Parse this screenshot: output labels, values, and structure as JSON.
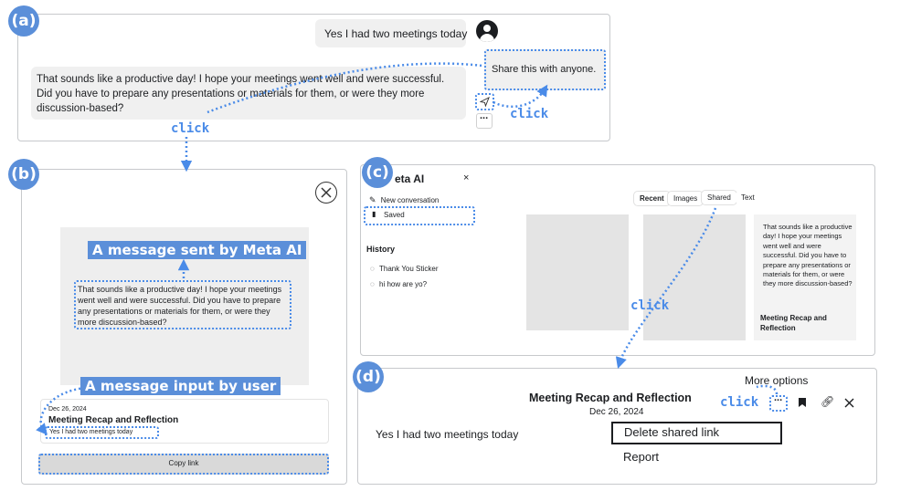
{
  "panel_a": {
    "badge": "(a)",
    "user_message": "Yes I had two meetings today",
    "ai_message": "That sounds like a productive day! I hope your meetings went well and were successful. Did you have to prepare any presentations or materials for them, or were they more discussion-based?",
    "tooltip": "Share this with anyone.",
    "more_icon": "ellipsis-icon",
    "share_icon": "send-icon",
    "click_1": "click",
    "click_2": "click"
  },
  "panel_b": {
    "badge": "(b)",
    "label_ai": "A message sent by Meta AI",
    "ai_preview": "That sounds like a productive day! I hope your meetings went well and were successful. Did you have to prepare any presentations or materials for them, or were they more discussion-based?",
    "label_user": "A message input by user",
    "date": "Dec 26, 2024",
    "title": "Meeting Recap and Reflection",
    "user_snippet": "Yes I had two meetings today",
    "copy_link": "Copy link",
    "close_icon": "close-icon"
  },
  "panel_c": {
    "badge": "(c)",
    "brand": "eta AI",
    "close": "×",
    "new_conversation": "New conversation",
    "saved": "Saved",
    "history_heading": "History",
    "history": [
      "Thank You Sticker",
      "hi how are yo?"
    ],
    "tabs": [
      "Recent",
      "Images",
      "Shared",
      "Text"
    ],
    "card_text": "That sounds like a productive day! I hope your meetings went well and were successful. Did you have to prepare any presentations or materials for them, or were they more discussion-based?",
    "card_title": "Meeting Recap and Reflection",
    "click": "click"
  },
  "panel_d": {
    "badge": "(d)",
    "more_options": "More options",
    "title": "Meeting Recap and Reflection",
    "date_partial": "Dec 26, 2024",
    "user_message": "Yes I had two meetings today",
    "menu": [
      "Delete shared link",
      "Report"
    ],
    "click": "click"
  },
  "colors": {
    "accent": "#4a8be8",
    "badge": "#5b8fd9",
    "bubble": "#f0f0f0"
  }
}
